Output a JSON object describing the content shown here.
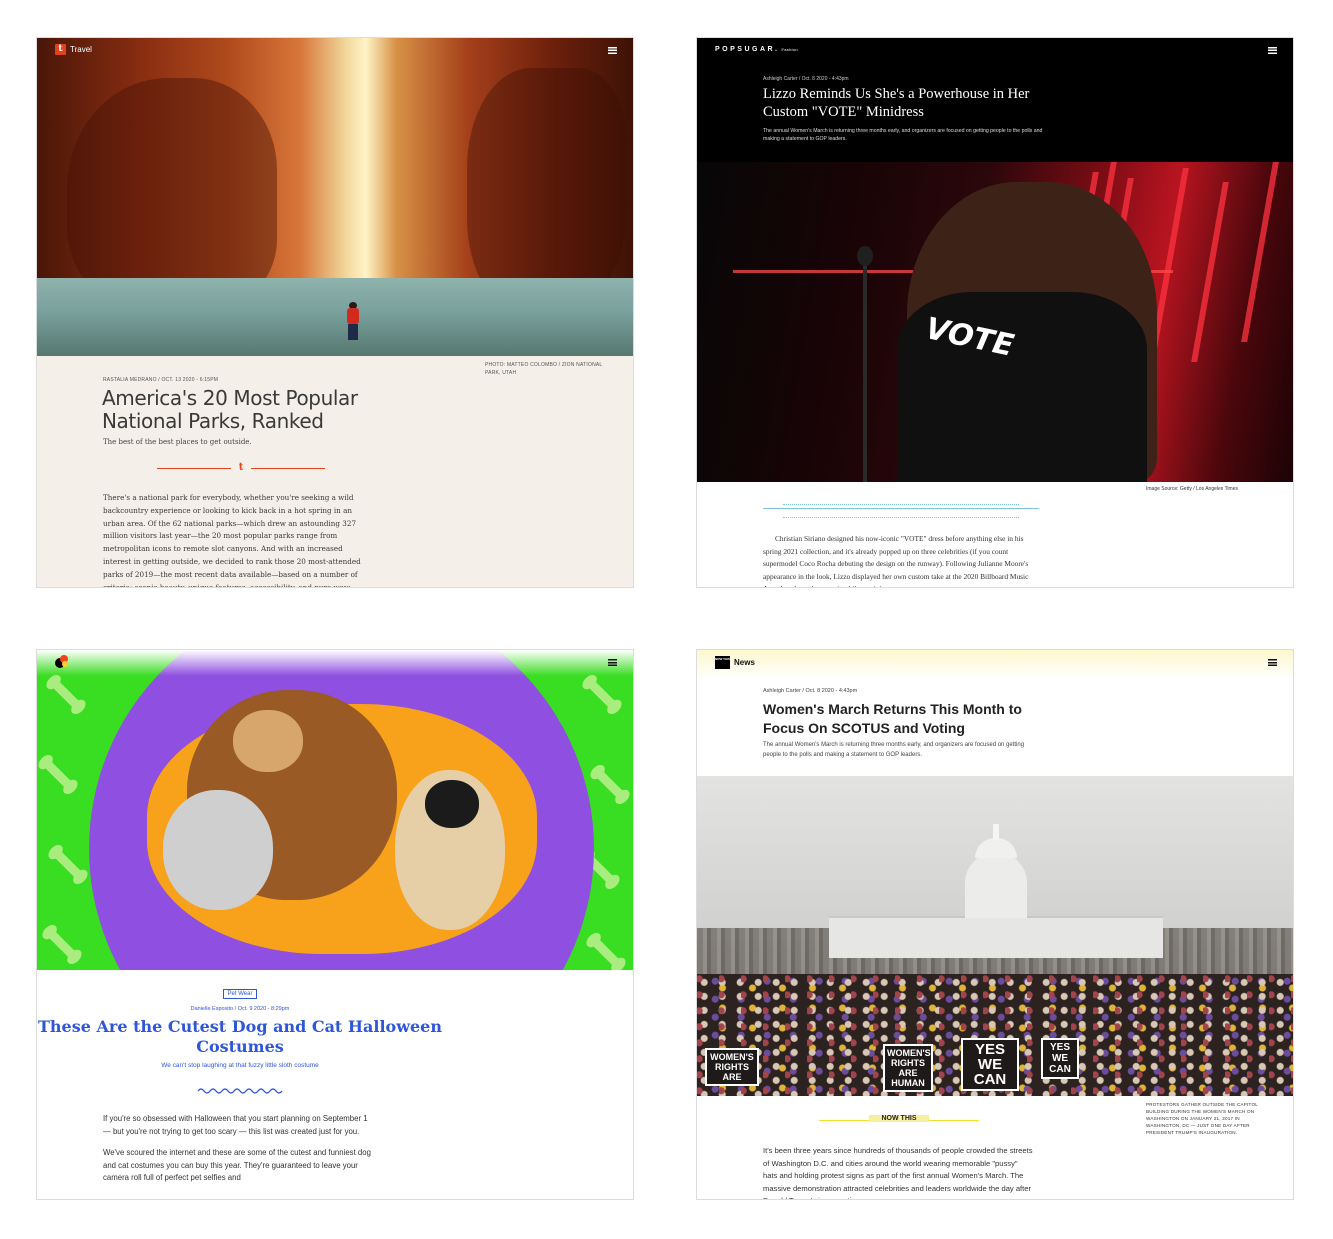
{
  "panel1": {
    "section": "Travel",
    "logo_letter": "t",
    "photo_credit": "PHOTO: MATTEO COLOMBO / ZION NATIONAL PARK, UTAH",
    "byline": "RASTALIA MEDRANO / OCT. 13 2020 - 6:15PM",
    "title": "America's 20 Most Popular National Parks, Ranked",
    "dek": "The best of the best places to get outside.",
    "divider_mark": "t",
    "body": "There's a national park for everybody, whether you're seeking a wild backcountry experience or looking to kick back in a hot spring in an urban area. Of the 62 national parks—which drew an astounding 327 million visitors last year—the 20 most popular parks range from metropolitan icons to remote slot canyons. And with an increased interest in getting outside, we decided to rank those 20 most-attended parks of 2019—the most recent data available—based on a number of criteria: scenic beauty, unique features, accessibility, and pure wow"
  },
  "panel2": {
    "brand": "POPSUGAR.",
    "brand_section": "Fashion",
    "byline": "Ashleigh Carter / Oct. 8 2020 - 4:43pm",
    "title": "Lizzo Reminds Us She's a Powerhouse in Her Custom \"VOTE\" Minidress",
    "dek": "The annual Women's March is returning three months early, and organizers are focused on getting people to the polls and making a statement to GOP leaders.",
    "dress_text": "VOTE",
    "caption": "Image Source: Getty / Los Angeles Times",
    "body": "Christian Siriano designed his now-iconic \"VOTE\" dress before anything else in his spring 2021 collection, and it's already popped up on three celebrities (if you count supermodel Coco Rocha debuting the design on the runway). Following Julianne Moore's appearance in the look, Lizzo displayed her own custom take at the 2020 Billboard Music Awards, where she wore it while receiving"
  },
  "panel3": {
    "tag": "Pet Wear",
    "byline": "Danielle Esposito / Oct. 9 2020 - 8:29pm",
    "title": "These Are the Cutest Dog and Cat Halloween Costumes",
    "dek": "We can't stop laughing at that fuzzy little sloth costume",
    "body_p1": "If you're so obsessed with Halloween that you start planning on September 1 — but you're not trying to get too scary — this list was created just for you.",
    "body_p2": "We've scoured the internet and these are some of the cutest and funniest dog and cat costumes you can buy this year. They're guaranteed to leave your camera roll full of perfect pet selfies and"
  },
  "panel4": {
    "logo_text": "NOW THIS",
    "section": "News",
    "byline": "Ashleigh Carter / Oct. 8 2020 - 4:43pm",
    "title": "Women's March Returns This Month to Focus On SCOTUS and Voting",
    "dek": "The annual Women's March is returning three months early, and organizers are focused on getting people to the polls and making a statement to GOP leaders.",
    "sign1": "WOMEN'S RIGHTS ARE",
    "sign2": "WOMEN'S RIGHTS ARE HUMAN",
    "sign3": "YES WE CAN",
    "sign4": "YES WE CAN",
    "caption": "PROTESTORS GATHER OUTSIDE THE CAPITOL BUILDING DURING THE WOMEN'S MARCH ON WASHINGTON ON JANUARY 21, 2017 IN WASHINGTON, DC — JUST ONE DAY AFTER PRESIDENT TRUMP'S INAUGURATION.",
    "nowthis_label": "NOW THIS",
    "body": "It's been three years since hundreds of thousands of people crowded the streets of Washington D.C. and cities around the world wearing memorable \"pussy\" hats and holding protest signs as part of the first annual Women's March. The massive demonstration attracted celebrities and leaders worldwide the day after Donald Trump's inauguration."
  }
}
